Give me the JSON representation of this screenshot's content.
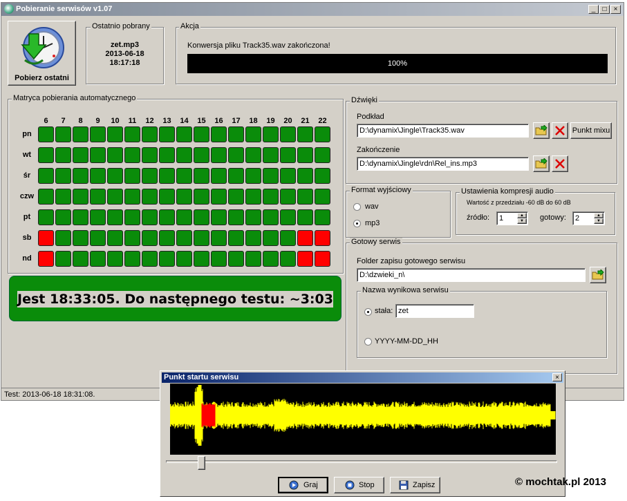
{
  "window": {
    "title": "Pobieranie serwisów v1.07",
    "min": "_",
    "max": "□",
    "close": "×"
  },
  "top": {
    "fetch_last_button": "Pobierz ostatni",
    "last_fetched": {
      "legend": "Ostatnio pobrany",
      "file": "zet.mp3",
      "date": "2013-06-18",
      "time": "18:17:18"
    },
    "action": {
      "legend": "Akcja",
      "message": "Konwersja pliku Track35.wav zakończona!",
      "progress_text": "100%",
      "progress": 1.0
    }
  },
  "matrix": {
    "legend": "Matryca pobierania automatycznego",
    "hours": [
      "6",
      "7",
      "8",
      "9",
      "10",
      "11",
      "12",
      "13",
      "14",
      "15",
      "16",
      "17",
      "18",
      "19",
      "20",
      "21",
      "22"
    ],
    "days": [
      {
        "label": "pn",
        "cells": [
          1,
          1,
          1,
          1,
          1,
          1,
          1,
          1,
          1,
          1,
          1,
          1,
          1,
          1,
          1,
          1,
          1
        ]
      },
      {
        "label": "wt",
        "cells": [
          1,
          1,
          1,
          1,
          1,
          1,
          1,
          1,
          1,
          1,
          1,
          1,
          1,
          1,
          1,
          1,
          1
        ]
      },
      {
        "label": "śr",
        "cells": [
          1,
          1,
          1,
          1,
          1,
          1,
          1,
          1,
          1,
          1,
          1,
          1,
          1,
          1,
          1,
          1,
          1
        ]
      },
      {
        "label": "czw",
        "cells": [
          1,
          1,
          1,
          1,
          1,
          1,
          1,
          1,
          1,
          1,
          1,
          1,
          1,
          1,
          1,
          1,
          1
        ]
      },
      {
        "label": "pt",
        "cells": [
          1,
          1,
          1,
          1,
          1,
          1,
          1,
          1,
          1,
          1,
          1,
          1,
          1,
          1,
          1,
          1,
          1
        ]
      },
      {
        "label": "sb",
        "cells": [
          0,
          1,
          1,
          1,
          1,
          1,
          1,
          1,
          1,
          1,
          1,
          1,
          1,
          1,
          1,
          0,
          0
        ]
      },
      {
        "label": "nd",
        "cells": [
          0,
          1,
          1,
          1,
          1,
          1,
          1,
          1,
          1,
          1,
          1,
          1,
          1,
          1,
          1,
          0,
          0
        ]
      }
    ],
    "colors": {
      "on": "#0a8c0a",
      "off": "#ff0000"
    }
  },
  "clock_text": "Jest 18:33:05. Do następnego testu: ~3:03",
  "sounds": {
    "legend": "Dźwięki",
    "bed_label": "Podkład",
    "bed_path": "D:\\dynamix\\Jingle\\Track35.wav",
    "mix_point_button": "Punkt mixu",
    "ending_label": "Zakończenie",
    "ending_path": "D:\\dynamix\\Jingle\\rdn\\Rel_ins.mp3"
  },
  "format": {
    "legend": "Format wyjściowy",
    "options": [
      "wav",
      "mp3"
    ],
    "selected": "mp3"
  },
  "compression": {
    "legend": "Ustawienia kompresji audio",
    "hint": "Wartość z przedziału -60 dB do 60 dB",
    "source_label": "źródło:",
    "source_value": "1",
    "ready_label": "gotowy:",
    "ready_value": "2"
  },
  "ready": {
    "legend": "Gotowy serwis",
    "folder_label": "Folder zapisu gotowego serwisu",
    "folder_path": "D:\\dzwieki_n\\",
    "name_legend": "Nazwa wynikowa serwisu",
    "const_label": "stała:",
    "const_value": "zet",
    "date_label": "YYYY-MM-DD_HH",
    "selected": "const"
  },
  "status_bar": "Test: 2013-06-18 18:31:08.",
  "dialog": {
    "title": "Punkt startu serwisu",
    "close": "×",
    "play": "Graj",
    "stop": "Stop",
    "save": "Zapisz",
    "slider_position": 0.09,
    "selection_start": 0.083,
    "selection_end": 0.117,
    "wave_color": "#ffff00",
    "selection_color": "#ff0000"
  },
  "copyright": "© mochtak.pl 2013"
}
